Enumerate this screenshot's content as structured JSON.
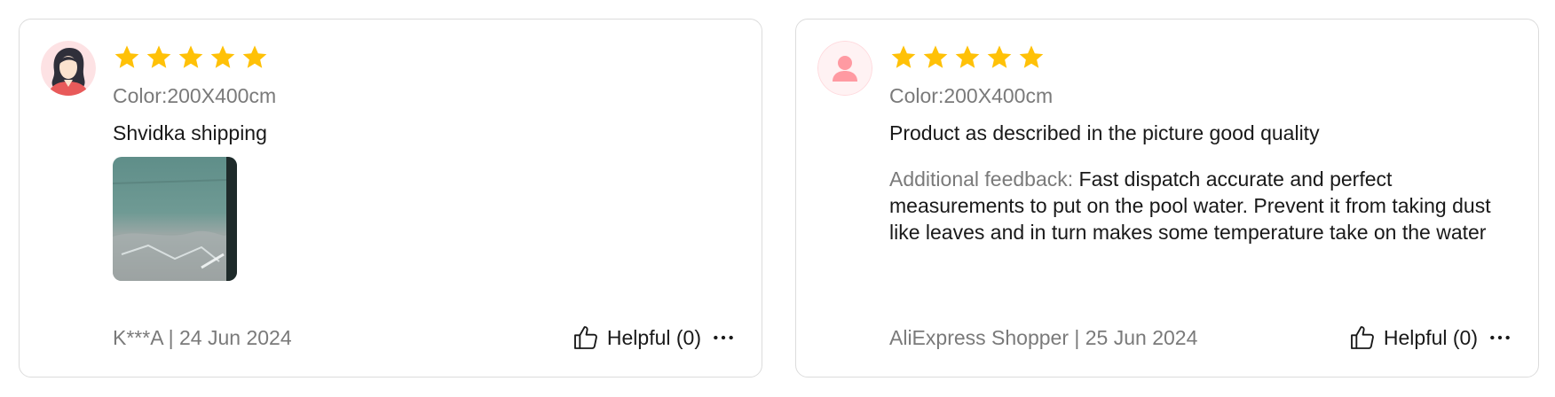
{
  "colors": {
    "star": "#FFC107",
    "card_border": "#dcdcdc",
    "muted_text": "#7a7a7a",
    "primary_text": "#191919"
  },
  "reviews": [
    {
      "avatar": "woman-avatar-icon",
      "rating": 5,
      "max_rating": 5,
      "sku": "Color:200X400cm",
      "text": "Shvidka shipping",
      "has_image": true,
      "additional_label": "",
      "additional_text": "",
      "author_date": "K***A | 24 Jun 2024",
      "helpful_label": "Helpful (0)"
    },
    {
      "avatar": "default-user-avatar-icon",
      "rating": 5,
      "max_rating": 5,
      "sku": "Color:200X400cm",
      "text": "Product as described in the picture good quality",
      "has_image": false,
      "additional_label": "Additional feedback:",
      "additional_text": "Fast dispatch accurate and perfect measurements to put on the pool water. Prevent it from taking dust like leaves and in turn makes some temperature take on the water",
      "author_date": "AliExpress Shopper | 25 Jun 2024",
      "helpful_label": "Helpful (0)"
    }
  ]
}
